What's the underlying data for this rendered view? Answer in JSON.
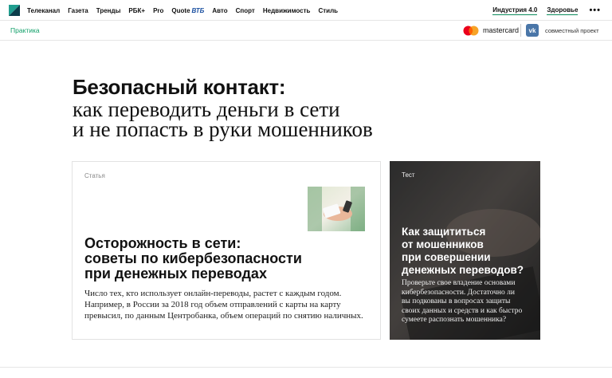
{
  "nav": {
    "items": [
      "Телеканал",
      "Газета",
      "Тренды",
      "РБК+",
      "Pro",
      "Quote",
      "Авто",
      "Спорт",
      "Недвижимость",
      "Стиль"
    ],
    "quote_partner": "ВТБ",
    "right": [
      "Индустрия 4.0",
      "Здоровье"
    ],
    "more": "•••"
  },
  "subbar": {
    "section": "Практика",
    "partner": "mastercard",
    "joint": "совместный проект"
  },
  "headline": {
    "bold": "Безопасный контакт:",
    "line2": "как переводить деньги в сети",
    "line3": "и не попасть в руки мошенников"
  },
  "article": {
    "tag": "Статья",
    "title": [
      "Осторожность в сети:",
      "советы по кибербезопасности",
      "при денежных переводах"
    ],
    "text": [
      "Число тех, кто использует онлайн-переводы, растет с каждым годом.",
      "Например, в России за 2018 год объем отправлений с карты на карту",
      "превысил, по данным Центробанка, объем операций по снятию наличных."
    ]
  },
  "test": {
    "tag": "Тест",
    "title": [
      "Как защититься",
      "от мошенников",
      "при совершении",
      "денежных переводов?"
    ],
    "text": [
      "Проверьте свое владение основами",
      "кибербезопасности. Достаточно ли",
      "вы подкованы в вопросах защиты",
      "своих данных и средств и как быстро",
      "сумеете распознать мошенника?"
    ]
  },
  "colors": {
    "accent_green": "#12a06a",
    "underline_green": "#0a8a5a",
    "vk_blue": "#4a76a8",
    "vtb_blue": "#1a4fa0"
  }
}
